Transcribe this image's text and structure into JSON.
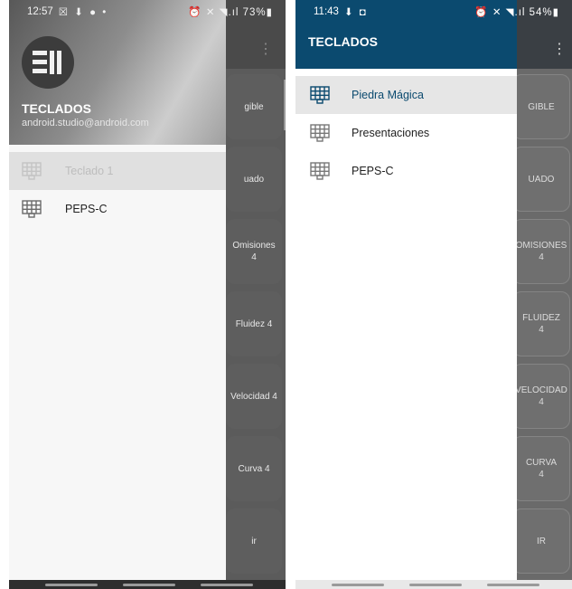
{
  "left_phone": {
    "status": {
      "time": "12:57",
      "left_icons": "☒ ⬇ ● •",
      "right_icons": "⏰ ✕ ◥.ıl 73%▮"
    },
    "background": {
      "overflow": "⋮",
      "buttons": [
        "gible",
        "uado",
        "Omisiones\n4",
        "Fluidez 4",
        "Velocidad 4",
        "Curva 4",
        "ir"
      ]
    },
    "drawer": {
      "title": "TECLADOS",
      "email": "android.studio@android.com",
      "items": [
        {
          "label": "Teclado 1",
          "icon": "keyboard-grid-icon",
          "selected": true
        },
        {
          "label": "PEPS-C",
          "icon": "keyboard-grid-icon",
          "selected": false
        }
      ]
    }
  },
  "right_phone": {
    "status": {
      "time": "11:43",
      "left_icons": "⬇ ◘",
      "right_icons": "⏰ ✕ ◥.ıl 54%▮"
    },
    "background": {
      "overflow": "⋮",
      "buttons": [
        "GIBLE",
        "UADO",
        "OMISIONES\n4",
        "FLUIDEZ\n4",
        "VELOCIDAD\n4",
        "CURVA\n4",
        "IR"
      ]
    },
    "drawer": {
      "title": "TECLADOS",
      "items": [
        {
          "label": "Piedra Mágica",
          "icon": "keyboard-grid-icon",
          "selected": true
        },
        {
          "label": "Presentaciones",
          "icon": "keyboard-grid-icon",
          "selected": false
        },
        {
          "label": "PEPS-C",
          "icon": "keyboard-grid-icon",
          "selected": false
        }
      ]
    }
  },
  "colors": {
    "accent": "#0b4a6f",
    "selected_bg": "#e6e6e6"
  }
}
